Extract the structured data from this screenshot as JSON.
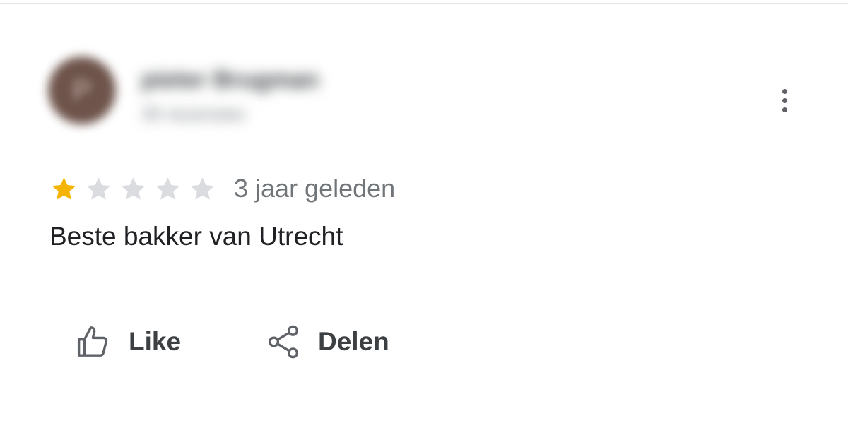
{
  "reviewer": {
    "name": "pieter Brugman",
    "meta": "30 recensies",
    "avatar_initial": "P"
  },
  "review": {
    "rating": 1,
    "max_rating": 5,
    "date": "3 jaar geleden",
    "text": "Beste bakker van Utrecht"
  },
  "actions": {
    "like_label": "Like",
    "share_label": "Delen",
    "more_icon": "more-vert-icon"
  },
  "colors": {
    "star_filled": "#f4b400",
    "star_empty": "#dadce0",
    "text_primary": "#202124",
    "text_secondary": "#70757a"
  }
}
